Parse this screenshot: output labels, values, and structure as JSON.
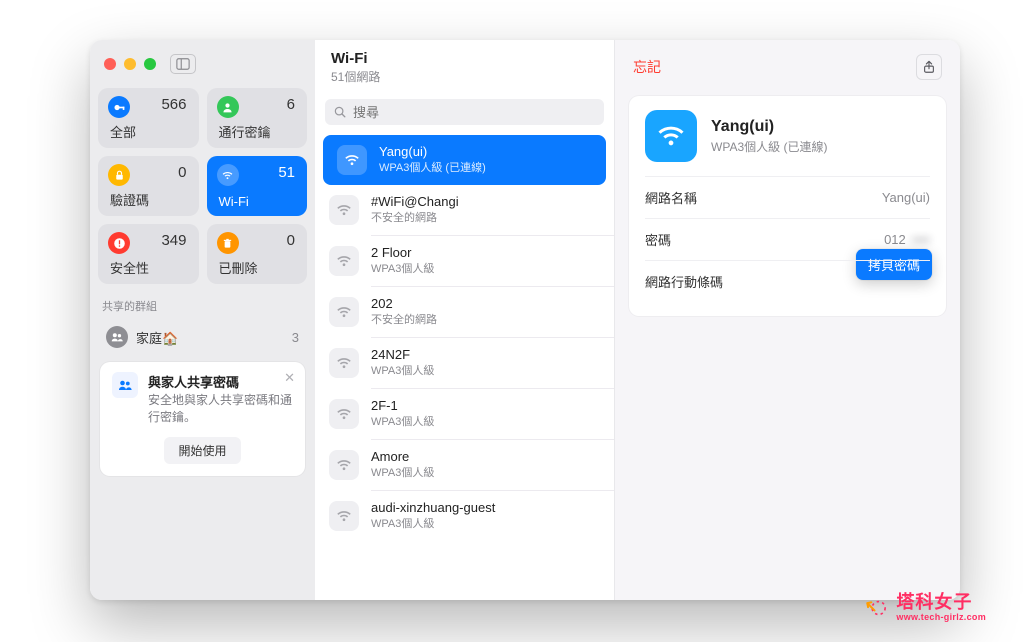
{
  "sidebar": {
    "tiles": [
      {
        "label": "全部",
        "count": 566,
        "icon": "key",
        "color": "#0a7aff"
      },
      {
        "label": "通行密鑰",
        "count": 6,
        "icon": "person",
        "color": "#34c759"
      },
      {
        "label": "驗證碼",
        "count": 0,
        "icon": "lock",
        "color": "#ffb800"
      },
      {
        "label": "Wi-Fi",
        "count": 51,
        "icon": "wifi",
        "color": "#19a5ff",
        "selected": true
      },
      {
        "label": "安全性",
        "count": 349,
        "icon": "alert",
        "color": "#ff3b30"
      },
      {
        "label": "已刪除",
        "count": 0,
        "icon": "trash",
        "color": "#ff9500"
      }
    ],
    "shared_section_label": "共享的群組",
    "groups": [
      {
        "label": "家庭🏠",
        "count": 3
      }
    ],
    "share_card": {
      "title": "與家人共享密碼",
      "desc": "安全地與家人共享密碼和通行密鑰。",
      "button": "開始使用"
    }
  },
  "list": {
    "title": "Wi-Fi",
    "subtitle": "51個網路",
    "search_placeholder": "搜尋",
    "items": [
      {
        "name": "Yang(ui)",
        "sub": "WPA3個人級 (已連線)",
        "selected": true
      },
      {
        "name": "#WiFi@Changi",
        "sub": "不安全的網路"
      },
      {
        "name": "2 Floor",
        "sub": "WPA3個人級"
      },
      {
        "name": "202",
        "sub": "不安全的網路"
      },
      {
        "name": "24N2F",
        "sub": "WPA3個人級"
      },
      {
        "name": "2F-1",
        "sub": "WPA3個人級"
      },
      {
        "name": "Amore",
        "sub": "WPA3個人級"
      },
      {
        "name": "audi-xinzhuang-guest",
        "sub": "WPA3個人級"
      }
    ]
  },
  "detail": {
    "forget": "忘記",
    "title": "Yang(ui)",
    "subtitle": "WPA3個人級 (已連線)",
    "rows": {
      "network_name": {
        "label": "網路名稱",
        "value": "Yang(ui)"
      },
      "password": {
        "label": "密碼",
        "value": "012",
        "hidden_tail": "••••"
      },
      "qr": {
        "label": "網路行動條碼"
      }
    },
    "copy_button": "拷貝密碼"
  },
  "watermark": {
    "line1": "塔科女子",
    "line2": "www.tech-girlz.com"
  }
}
